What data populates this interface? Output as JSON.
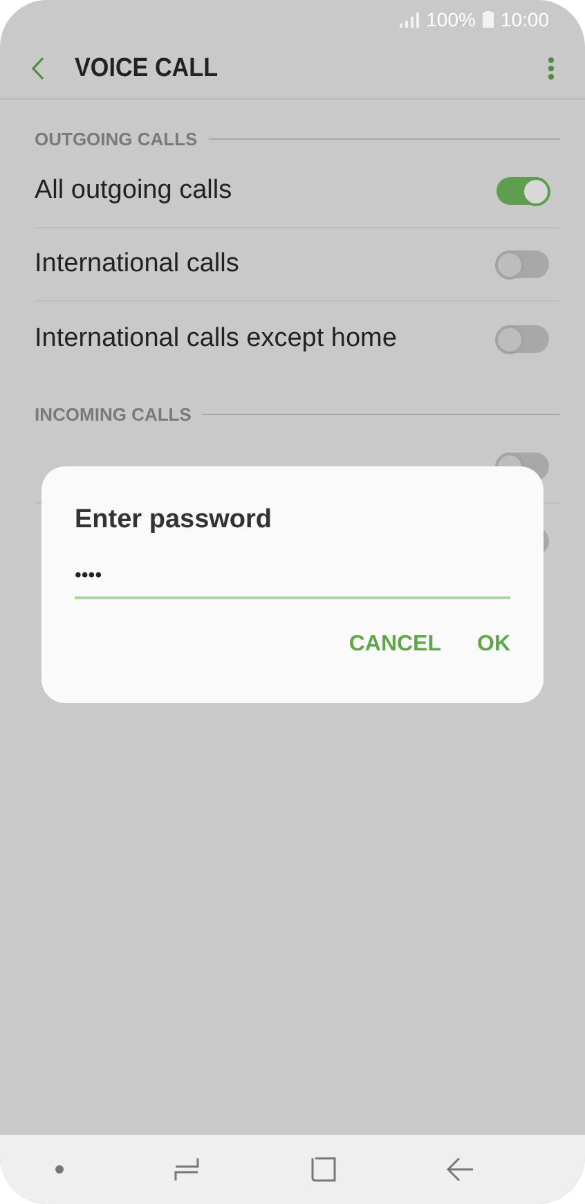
{
  "status_bar": {
    "battery": "100%",
    "time": "10:00"
  },
  "header": {
    "title": "VOICE CALL"
  },
  "sections": [
    {
      "title": "OUTGOING CALLS",
      "items": [
        {
          "label": "All outgoing calls",
          "on": true
        },
        {
          "label": "International calls",
          "on": false
        },
        {
          "label": "International calls except home",
          "on": false
        }
      ]
    },
    {
      "title": "INCOMING CALLS",
      "items": [
        {
          "on": false
        },
        {
          "on": false
        }
      ]
    }
  ],
  "dialog": {
    "title": "Enter password",
    "value": "••••",
    "buttons": [
      "CANCEL",
      "OK"
    ]
  }
}
